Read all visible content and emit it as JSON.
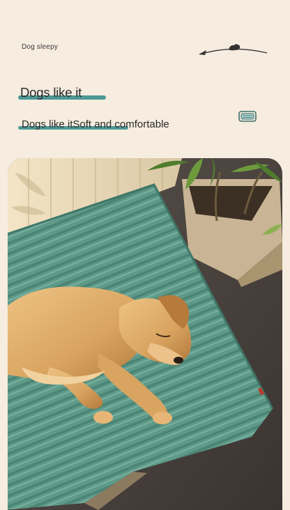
{
  "header": {
    "tag": "Dog sleepy",
    "headline": "Dogs like it",
    "subline": "Dogs like itSoft and comfortable"
  },
  "icons": {
    "arrow": "arrow-left-with-dog-silhouette-icon",
    "bed": "pet-bed-icon"
  },
  "photo": {
    "subject": "dog-sleeping-on-green-mat-photo"
  },
  "colors": {
    "background": "#f6ecdf",
    "accent": "#4d9996",
    "mat": "#5f9a89",
    "dog": "#d9a460"
  }
}
